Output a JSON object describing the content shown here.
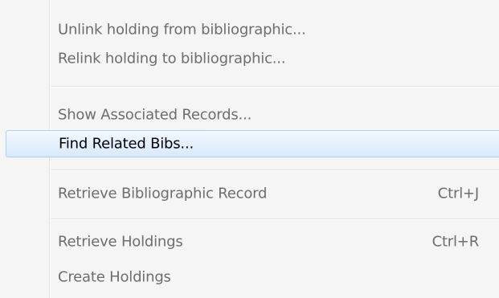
{
  "menu": {
    "items": [
      {
        "label": "Unlink holding from bibliographic...",
        "shortcut": ""
      },
      {
        "label": "Relink holding to bibliographic...",
        "shortcut": ""
      },
      {
        "label": "Show Associated Records...",
        "shortcut": ""
      },
      {
        "label": "Find Related Bibs...",
        "shortcut": "",
        "highlighted": true
      },
      {
        "label": "Retrieve Bibliographic Record",
        "shortcut": "Ctrl+J"
      },
      {
        "label": "Retrieve Holdings",
        "shortcut": "Ctrl+R"
      },
      {
        "label": "Create Holdings",
        "shortcut": ""
      }
    ]
  },
  "colors": {
    "menu_background": "#f5f5f5",
    "text_enabled": "#000000",
    "text_dimmed": "#6d6d6d",
    "highlight_border": "#aecff7",
    "highlight_fill": "#e3effd"
  }
}
